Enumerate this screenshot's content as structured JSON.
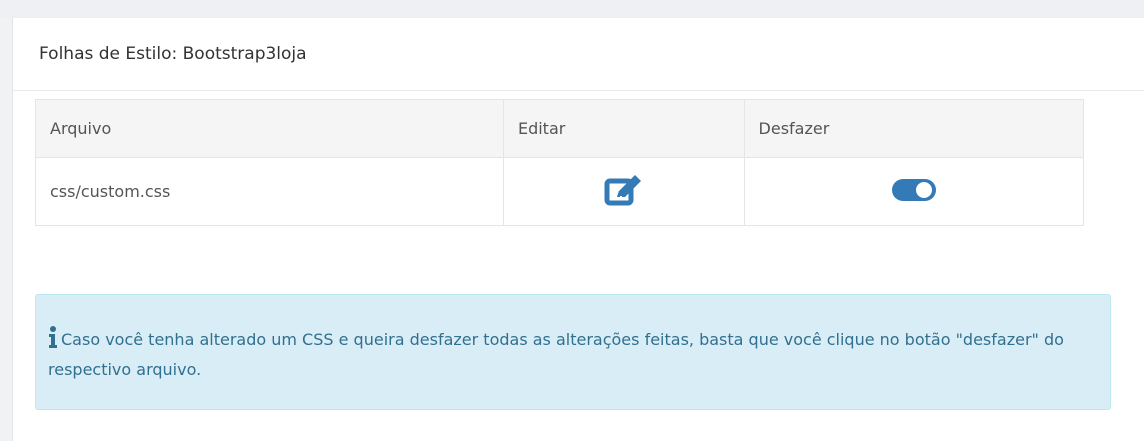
{
  "panel": {
    "title": "Folhas de Estilo: Bootstrap3loja"
  },
  "table": {
    "headers": [
      "Arquivo",
      "Editar",
      "Desfazer"
    ],
    "rows": [
      {
        "file": "css/custom.css",
        "edit_icon": "edit-icon",
        "undo_icon": "toggle-on-icon"
      }
    ]
  },
  "alert": {
    "icon": "info-icon",
    "text": "Caso você tenha alterado um CSS e queira desfazer todas as alterações feitas, basta que você clique no botão \"desfazer\" do respectivo arquivo."
  },
  "colors": {
    "accent": "#337ab7",
    "alert_bg": "#d9edf7",
    "alert_text": "#31708f"
  }
}
